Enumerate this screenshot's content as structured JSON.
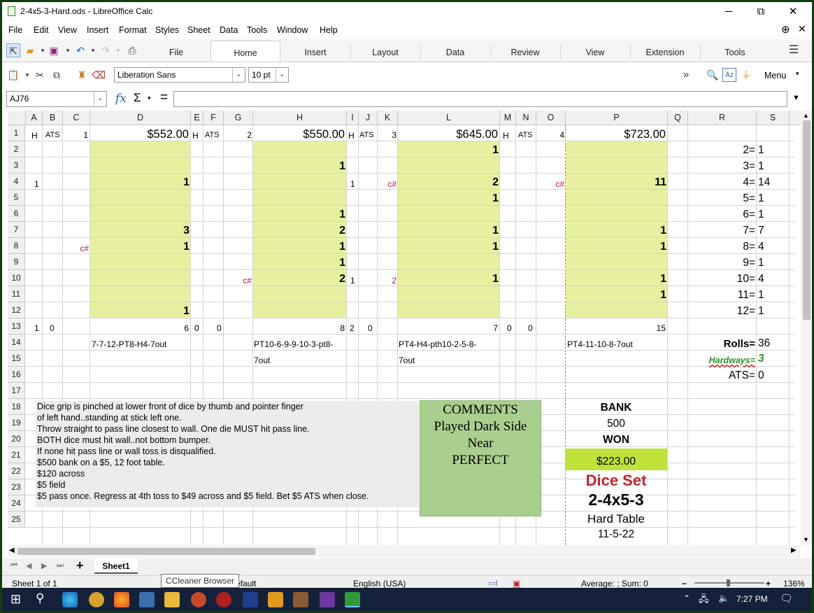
{
  "window": {
    "title": "2-4x5-3-Hard.ods - LibreOffice Calc",
    "minimize": "─",
    "maximize": "⧉",
    "close": "✕"
  },
  "menu": [
    "File",
    "Edit",
    "View",
    "Insert",
    "Format",
    "Styles",
    "Sheet",
    "Data",
    "Tools",
    "Window",
    "Help"
  ],
  "nb_tabs": [
    "File",
    "Home",
    "Insert",
    "Layout",
    "Data",
    "Review",
    "View",
    "Extension",
    "Tools"
  ],
  "active_tab": "Home",
  "font": {
    "name": "Liberation Sans",
    "size": "10 pt"
  },
  "menu_button": "Menu",
  "name_box": "AJ76",
  "formula": "",
  "columns": [
    "A",
    "B",
    "C",
    "D",
    "E",
    "F",
    "G",
    "H",
    "I",
    "J",
    "K",
    "L",
    "M",
    "N",
    "O",
    "P",
    "Q",
    "R",
    "S"
  ],
  "rows": [
    "1",
    "2",
    "3",
    "4",
    "5",
    "6",
    "7",
    "8",
    "9",
    "10",
    "11",
    "12",
    "13",
    "14",
    "15",
    "16",
    "17",
    "18",
    "19",
    "20",
    "21",
    "22",
    "23",
    "24",
    "25"
  ],
  "row1": {
    "a": "H",
    "b": "ATS",
    "c": "1",
    "d": "$552.00",
    "e": "H",
    "f": "ATS",
    "g": "2",
    "h": "$550.00",
    "i": "H",
    "j": "ATS",
    "k": "3",
    "l": "$645.00",
    "m": "H",
    "n": "ATS",
    "o": "4",
    "p": "$723.00"
  },
  "cells": {
    "d4": "1",
    "d7": "3",
    "d8": "1",
    "d12": "1",
    "h3": "1",
    "h6": "1",
    "h7": "2",
    "h8": "1",
    "h9": "1",
    "h10": "2",
    "l2": "1",
    "l4": "2",
    "l5": "1",
    "l7": "1",
    "l8": "1",
    "l10": "1",
    "p4": "11",
    "p7": "1",
    "p8": "1",
    "p10": "1",
    "p11": "1",
    "a4": "1",
    "i4": "1",
    "i10": "1",
    "k10": "2",
    "c8": "c#",
    "g10": "c#",
    "k4": "c#",
    "o4": "c#",
    "a13": "1",
    "b13": "0",
    "d13": "6",
    "e13": "0",
    "f13": "0",
    "h13": "8",
    "i13": "2",
    "j13": "0",
    "l13": "7",
    "m13": "0",
    "n13": "0",
    "p13": "15",
    "d14": "7-7-12-PT8-H4-7out",
    "h14": "PT10-6-9-9-10-3-pt8-",
    "h15": "7out",
    "l14": "PT4-H4-pth10-2-5-8-",
    "l15": "7out",
    "p14": "PT4-11-10-8-7out"
  },
  "summary": [
    {
      "label": "2=",
      "value": "1"
    },
    {
      "label": "3=",
      "value": "1"
    },
    {
      "label": "4=",
      "value": "14"
    },
    {
      "label": "5=",
      "value": "1"
    },
    {
      "label": "6=",
      "value": "1"
    },
    {
      "label": "7=",
      "value": "7"
    },
    {
      "label": "8=",
      "value": "4"
    },
    {
      "label": "9=",
      "value": "1"
    },
    {
      "label": "10=",
      "value": "4"
    },
    {
      "label": "11=",
      "value": "1"
    },
    {
      "label": "12=",
      "value": "1"
    }
  ],
  "rolls": {
    "label": "Rolls=",
    "value": "36"
  },
  "hardways": {
    "label": "Hardways=",
    "value": "3"
  },
  "ats": {
    "label": "ATS=",
    "value": "0"
  },
  "notes": [
    "Dice grip is pinched at lower front of dice by thumb and pointer finger",
    "of left hand..standing at stick left one.",
    "Throw straight to pass line closest to wall. One die MUST hit pass line.",
    "BOTH dice must hit wall..not bottom bumper.",
    "If none hit pass line or wall toss is disqualified.",
    "$500 bank  on a $5, 12 foot table.",
    "$120 across",
    "$5 field",
    "$5 pass once.   Regress at 4th toss to $49 across and $5 field. Bet $5 ATS when close."
  ],
  "comments": [
    "COMMENTS",
    "Played Dark Side",
    "Near",
    "PERFECT"
  ],
  "bank": {
    "label": "BANK",
    "value": "500",
    "won_label": "WON",
    "won_value": "$223.00",
    "dice_set": "Dice Set",
    "set_name": "2-4x5-3",
    "table": "Hard Table",
    "date": "11-5-22"
  },
  "sheet_tab": "Sheet1",
  "status": {
    "sheet": "Sheet 1 of 1",
    "style": "efault",
    "lang": "English (USA)",
    "calc": "Average: ; Sum: 0",
    "zoom": "136%"
  },
  "tooltip": "CCleaner Browser",
  "taskbar": {
    "time": "7:27 PM"
  },
  "colors": {
    "yellow": "#e8f0a0",
    "comment_bg": "#a9cf8f",
    "won_bg": "#bfe13a",
    "dice_set": "#c0272d",
    "magenta": "#b0165e",
    "hardways": "#2f8f2f"
  }
}
